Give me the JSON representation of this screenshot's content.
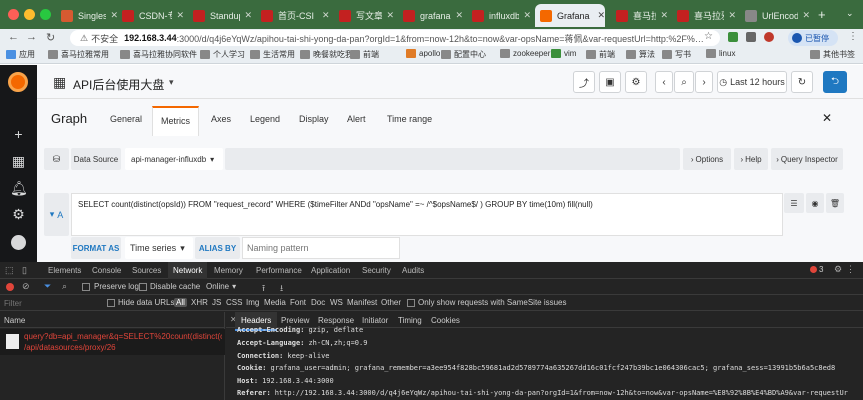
{
  "browser": {
    "tabs": [
      {
        "label": "Singlesta",
        "color": "#d65a31"
      },
      {
        "label": "CSDN-专",
        "color": "#c32120"
      },
      {
        "label": "Standup",
        "color": "#c32120"
      },
      {
        "label": "首页-CSI",
        "color": "#c32120"
      },
      {
        "label": "写文章-C",
        "color": "#c32120"
      },
      {
        "label": "grafana",
        "color": "#c32120"
      },
      {
        "label": "influxdb",
        "color": "#c32120"
      },
      {
        "label": "Grafana",
        "color": "#f46800",
        "active": true
      },
      {
        "label": "喜马拉雅",
        "color": "#c32120"
      },
      {
        "label": "喜马拉雅",
        "color": "#c32120"
      },
      {
        "label": "UrlEncod",
        "color": "#888888"
      }
    ],
    "security_label": "不安全",
    "url_host": "192.168.3.44",
    "url_rest": ":3000/d/q4j6eYqWz/apihou-tai-shi-yong-da-pan?orgId=1&from=now-12h&to=now&var-opsName=蒋佩&var-requestUrl=http:%2F%…",
    "paused_label": "已暂停",
    "bookmarks": [
      "应用",
      "喜马拉雅常用",
      "喜马拉雅协同软件",
      "个人学习",
      "生活常用",
      "晚餐就吃我",
      "前端",
      "apollo",
      "配置中心",
      "zookeeper",
      "vim",
      "前端",
      "算法",
      "写书",
      "linux"
    ],
    "other_bookmarks": "其他书签"
  },
  "grafana": {
    "dashboard_title": "API后台使用大盘",
    "time_range_label": "Last 12 hours",
    "editor_title": "Graph",
    "editor_tabs": [
      "General",
      "Metrics",
      "Axes",
      "Legend",
      "Display",
      "Alert",
      "Time range"
    ],
    "active_tab": "Metrics",
    "data_source_label": "Data Source",
    "data_source_value": "api-manager-influxdb",
    "options_label": "Options",
    "help_label": "Help",
    "query_inspector_label": "Query Inspector",
    "query_ref": "A",
    "query_text": "SELECT count(distinct(opsId)) FROM \"request_record\" WHERE ($timeFilter ANDd \"opsName\" =~ /^$opsName$/ )  GROUP BY time(10m) fill(null)",
    "format_as_label": "FORMAT AS",
    "format_as_value": "Time series",
    "alias_by_label": "ALIAS BY",
    "alias_placeholder": "Naming pattern",
    "accent": "#1f78c1"
  },
  "devtools": {
    "tabs": [
      "Elements",
      "Console",
      "Sources",
      "Network",
      "Memory",
      "Performance",
      "Application",
      "Security",
      "Audits"
    ],
    "active_tab": "Network",
    "error_count": "3",
    "preserve_log": "Preserve log",
    "disable_cache": "Disable cache",
    "online": "Online",
    "filter_placeholder": "Filter",
    "hide_data_urls": "Hide data URLs",
    "type_filters": [
      "All",
      "XHR",
      "JS",
      "CSS",
      "Img",
      "Media",
      "Font",
      "Doc",
      "WS",
      "Manifest",
      "Other"
    ],
    "samesite_label": "Only show requests with SameSite issues",
    "name_header": "Name",
    "request_line1": "query?db=api_manager&q=SELECT%20count(distinct(op...",
    "request_line2": "/api/datasources/proxy/26",
    "detail_tabs": [
      "Headers",
      "Preview",
      "Response",
      "Initiator",
      "Timing",
      "Cookies"
    ],
    "active_detail_tab": "Headers",
    "headers": [
      {
        "k": "Accept-Encoding:",
        "v": "gzip, deflate"
      },
      {
        "k": "Accept-Language:",
        "v": "zh-CN,zh;q=0.9"
      },
      {
        "k": "Connection:",
        "v": "keep-alive"
      },
      {
        "k": "Cookie:",
        "v": "grafana_user=admin; grafana_remember=a3ee954f828bc59681ad2d5789774a635267dd16c01fcf247b39bc1e064306cac5; grafana_sess=13991b5b6a5c8ed8"
      },
      {
        "k": "Host:",
        "v": "192.168.3.44:3000"
      },
      {
        "k": "Referer:",
        "v": "http://192.168.3.44:3000/d/q4j6eYqWz/apihou-tai-shi-yong-da-pan?orgId=1&from=now-12h&to=now&var-opsName=%E8%92%8B%E4%BD%A9&var-requestUr"
      }
    ]
  }
}
